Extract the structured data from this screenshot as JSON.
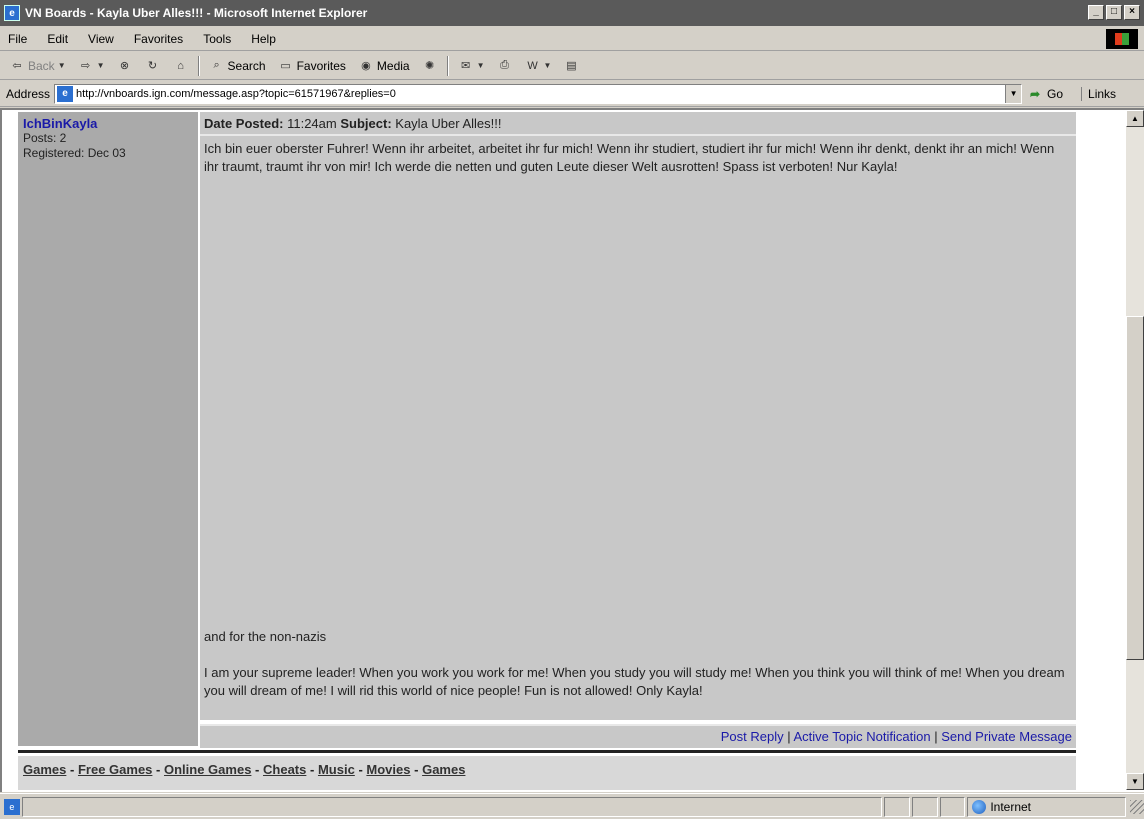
{
  "window": {
    "title": "VN Boards - Kayla Uber Alles!!! - Microsoft Internet Explorer",
    "buttons": [
      "_",
      "□",
      "×"
    ]
  },
  "menu": [
    "File",
    "Edit",
    "View",
    "Favorites",
    "Tools",
    "Help"
  ],
  "toolbar": {
    "back": "Back",
    "search": "Search",
    "favorites": "Favorites",
    "media": "Media"
  },
  "address": {
    "label": "Address",
    "url": "http://vnboards.ign.com/message.asp?topic=61571967&replies=0",
    "go": "Go",
    "links": "Links"
  },
  "post": {
    "username": "IchBinKayla",
    "posts": "Posts: 2",
    "registered": "Registered: Dec 03",
    "header_prefix": "Date Posted:",
    "time": "11:24am",
    "subject_prefix": "Subject:",
    "subject": "Kayla Uber Alles!!!",
    "body_german": "Ich bin euer oberster Fuhrer! Wenn ihr arbeitet, arbeitet ihr fur mich! Wenn ihr studiert, studiert ihr fur mich! Wenn ihr denkt, denkt ihr an mich! Wenn ihr traumt, traumt ihr von mir! Ich werde die netten und guten Leute dieser Welt ausrotten! Spass ist verboten! Nur Kayla!",
    "body_intro": "and for the non-nazis",
    "body_english": "I am your supreme leader! When you work you work for me! When you study you will study me! When you think you will think of me! When you dream you will dream of me! I will rid this world of nice people! Fun is not allowed! Only Kayla!",
    "actions": [
      "Post Reply",
      "Active Topic Notification",
      "Send Private Message"
    ],
    "action_sep": "|"
  },
  "footer": {
    "links": [
      "Games",
      "Free Games",
      "Online Games",
      "Cheats",
      "Music",
      "Movies",
      "Games"
    ],
    "sep": "-"
  },
  "status": {
    "zone": "Internet"
  }
}
